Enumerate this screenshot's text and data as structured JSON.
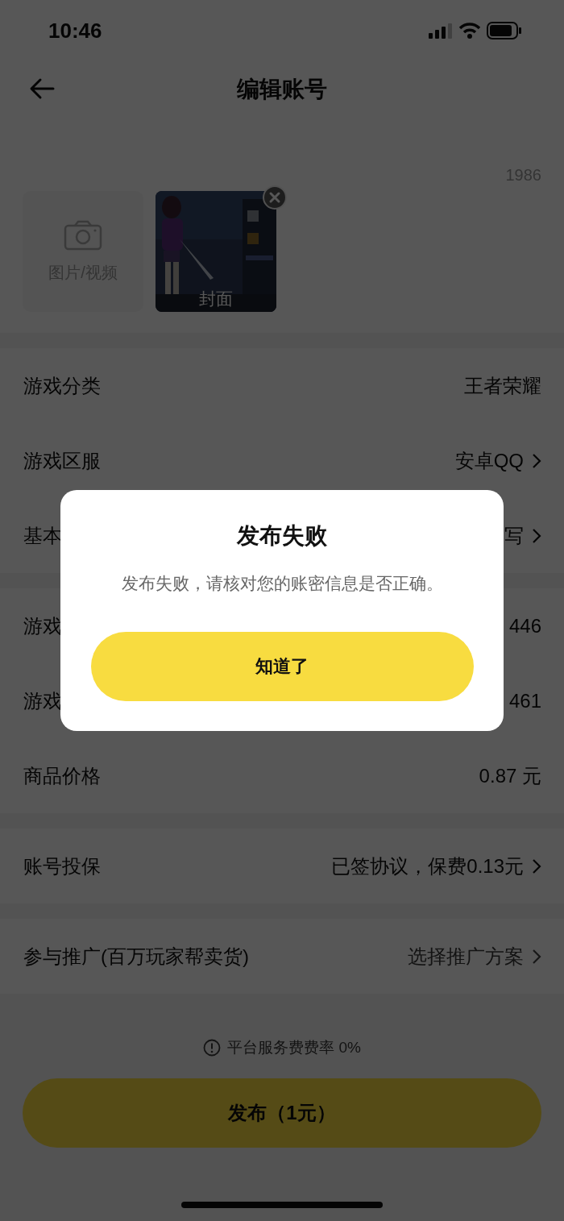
{
  "status_bar": {
    "time": "10:46"
  },
  "nav": {
    "title": "编辑账号"
  },
  "media": {
    "count": "1986",
    "add_tile": {
      "label": "图片/视频"
    },
    "cover": {
      "kind": "picture",
      "label": "封面"
    }
  },
  "sections": [
    {
      "rows": [
        {
          "label": "游戏分类",
          "value": "王者荣耀",
          "chevron": false,
          "hint": false
        },
        {
          "label": "游戏区服",
          "value": "安卓QQ",
          "chevron": true,
          "hint": false
        },
        {
          "label": "基本",
          "value": "写",
          "chevron": true,
          "hint": false
        }
      ]
    },
    {
      "rows": [
        {
          "label": "游戏",
          "value": "446",
          "chevron": false,
          "hint": false
        },
        {
          "label": "游戏",
          "value": "461",
          "chevron": false,
          "hint": false
        },
        {
          "label": "商品价格",
          "value": "0.87 元",
          "chevron": false,
          "hint": false
        }
      ]
    },
    {
      "rows": [
        {
          "label": "账号投保",
          "value": "已签协议，保费0.13元",
          "chevron": true,
          "hint": false
        }
      ]
    },
    {
      "rows": [
        {
          "label": "参与推广(百万玩家帮卖货)",
          "value": "选择推广方案",
          "chevron": true,
          "hint": true
        }
      ]
    }
  ],
  "fee_note": "平台服务费费率 0%",
  "publish_button": {
    "label": "发布（1元）"
  },
  "dialog": {
    "title": "发布失败",
    "message": "发布失败，请核对您的账密信息是否正确。",
    "button": "知道了"
  }
}
